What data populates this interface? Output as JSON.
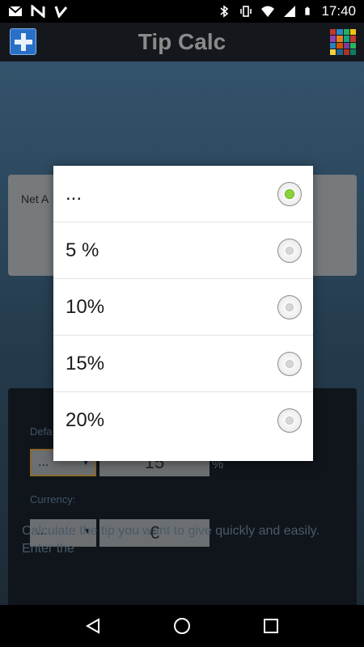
{
  "status_bar": {
    "time": "17:40",
    "left_icons": [
      "gmail-icon",
      "n-notification-icon",
      "check-notification-icon"
    ],
    "right_icons": [
      "bluetooth-icon",
      "vibrate-icon",
      "wifi-icon",
      "signal-icon",
      "battery-icon"
    ]
  },
  "action_bar": {
    "title": "Tip Calc",
    "grid_colors": [
      "#c0392b",
      "#2e86c1",
      "#27ae60",
      "#f1c40f",
      "#8e44ad",
      "#e67e22",
      "#16a085",
      "#c0392b",
      "#2980b9",
      "#d35400",
      "#7d3c98",
      "#28b463",
      "#f4d03f",
      "#1f618d",
      "#a93226",
      "#117a65"
    ]
  },
  "background": {
    "net_label": "Net A",
    "default_label": "Defa",
    "tip_select_value": "...",
    "tip_value": "15",
    "percent_sign": "%",
    "currency_label": "Currency:",
    "currency_select_value": "...",
    "currency_value": "€",
    "description": "Calculate the tip you want to give quickly and easily. Enter the"
  },
  "dialog": {
    "options": [
      {
        "label": "...",
        "checked": true
      },
      {
        "label": "5 %",
        "checked": false
      },
      {
        "label": "10%",
        "checked": false
      },
      {
        "label": "15%",
        "checked": false
      },
      {
        "label": "20%",
        "checked": false
      }
    ]
  },
  "colors": {
    "accent_selected": "#8bd23a",
    "add_button": "#2a6fc7"
  }
}
